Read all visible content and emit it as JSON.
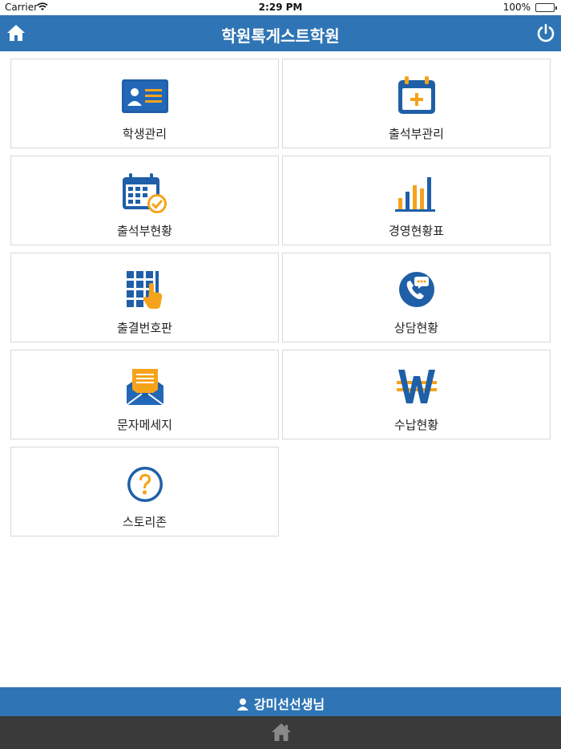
{
  "status": {
    "carrier": "Carrier",
    "time": "2:29 PM",
    "battery": "100%"
  },
  "header": {
    "title": "학원톡게스트학원",
    "home_icon": "home-icon",
    "power_icon": "power-icon"
  },
  "menu": [
    {
      "label": "학생관리",
      "icon": "student-id-card-icon"
    },
    {
      "label": "출석부관리",
      "icon": "calendar-add-icon"
    },
    {
      "label": "출석부현황",
      "icon": "calendar-check-icon"
    },
    {
      "label": "경영현황표",
      "icon": "bar-chart-icon"
    },
    {
      "label": "출결번호판",
      "icon": "keypad-icon"
    },
    {
      "label": "상담현황",
      "icon": "phone-chat-icon"
    },
    {
      "label": "문자메세지",
      "icon": "envelope-message-icon"
    },
    {
      "label": "수납현황",
      "icon": "won-currency-icon"
    },
    {
      "label": "스토리존",
      "icon": "question-icon"
    }
  ],
  "footer": {
    "user": "강미선선생님",
    "home_icon": "home-icon"
  },
  "colors": {
    "header_blue": "#2f75b5",
    "icon_blue": "#1f5fa8",
    "icon_orange": "#f5a31a",
    "bottom_bar": "#3a3a3a"
  }
}
